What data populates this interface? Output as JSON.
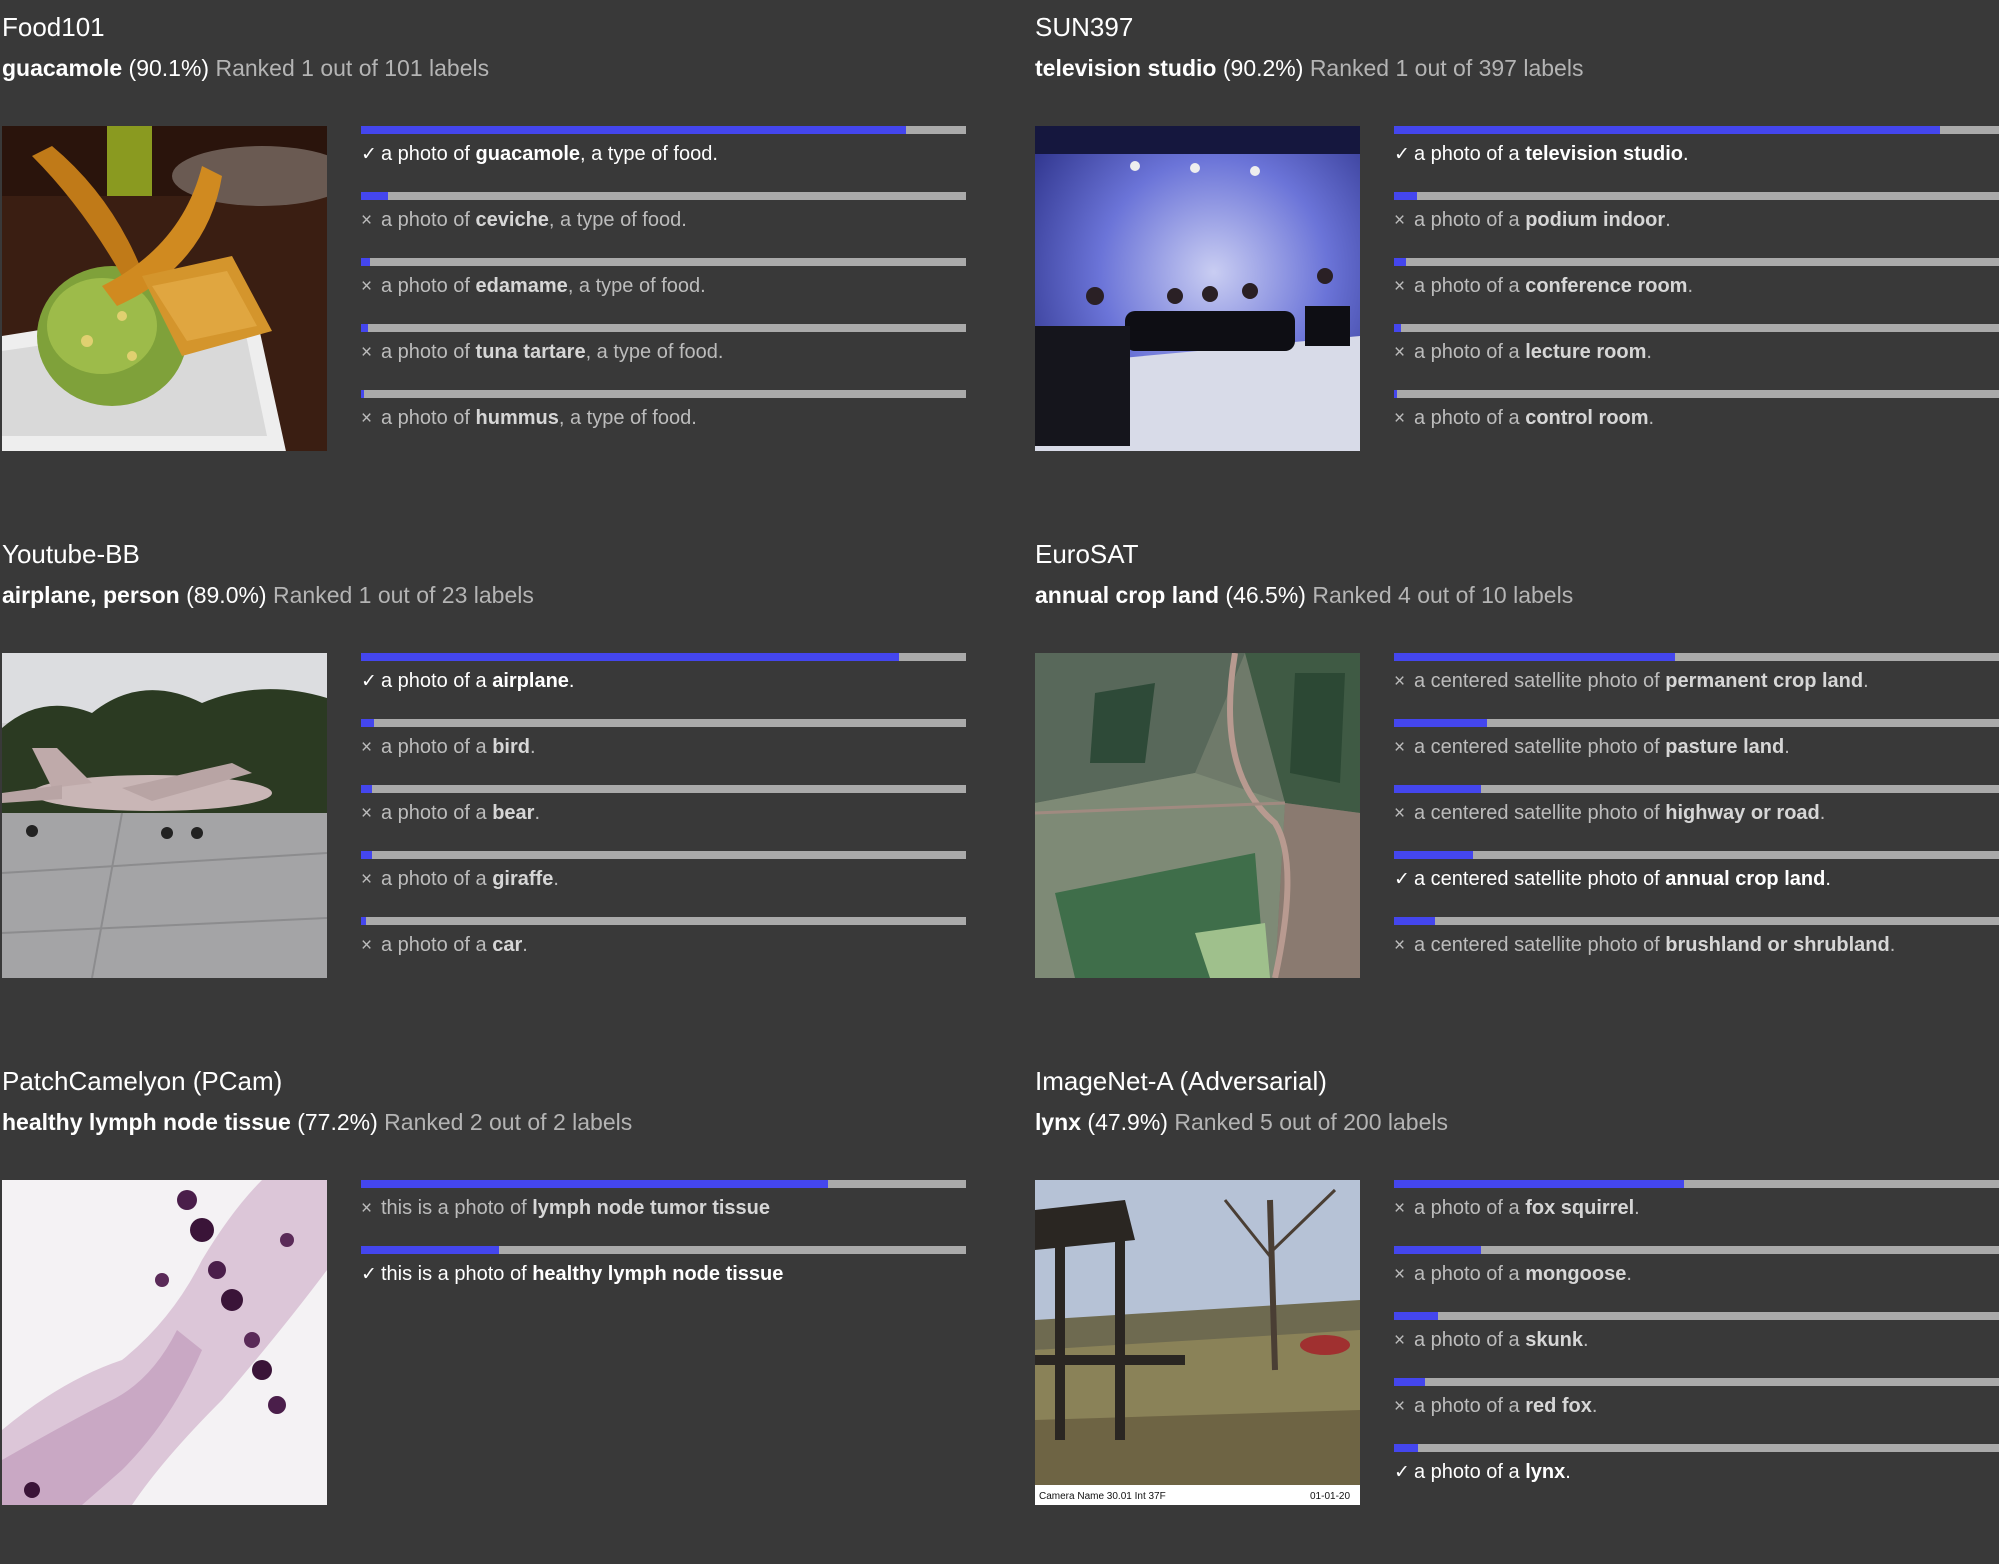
{
  "panels": [
    {
      "dataset": "Food101",
      "label": "guacamole",
      "score": "(90.1%)",
      "rank_text": "Ranked 1 out of 101 labels",
      "image_icon": "guacamole-photo",
      "options": [
        {
          "mark": "✓",
          "correct": true,
          "prefix": "a photo of ",
          "cls": "guacamole",
          "suffix": ", a type of food.",
          "prob": 0.901
        },
        {
          "mark": "×",
          "correct": false,
          "prefix": "a photo of ",
          "cls": "ceviche",
          "suffix": ", a type of food.",
          "prob": 0.045
        },
        {
          "mark": "×",
          "correct": false,
          "prefix": "a photo of ",
          "cls": "edamame",
          "suffix": ", a type of food.",
          "prob": 0.015
        },
        {
          "mark": "×",
          "correct": false,
          "prefix": "a photo of ",
          "cls": "tuna tartare",
          "suffix": ", a type of food.",
          "prob": 0.012
        },
        {
          "mark": "×",
          "correct": false,
          "prefix": "a photo of ",
          "cls": "hummus",
          "suffix": ", a type of food.",
          "prob": 0.005
        }
      ]
    },
    {
      "dataset": "SUN397",
      "label": "television studio",
      "score": "(90.2%)",
      "rank_text": "Ranked 1 out of 397 labels",
      "image_icon": "television-studio-photo",
      "options": [
        {
          "mark": "✓",
          "correct": true,
          "prefix": "a photo of a ",
          "cls": "television studio",
          "suffix": ".",
          "prob": 0.902
        },
        {
          "mark": "×",
          "correct": false,
          "prefix": "a photo of a ",
          "cls": "podium indoor",
          "suffix": ".",
          "prob": 0.038
        },
        {
          "mark": "×",
          "correct": false,
          "prefix": "a photo of a ",
          "cls": "conference room",
          "suffix": ".",
          "prob": 0.02
        },
        {
          "mark": "×",
          "correct": false,
          "prefix": "a photo of a ",
          "cls": "lecture room",
          "suffix": ".",
          "prob": 0.012
        },
        {
          "mark": "×",
          "correct": false,
          "prefix": "a photo of a ",
          "cls": "control room",
          "suffix": ".",
          "prob": 0.005
        }
      ]
    },
    {
      "dataset": "Youtube-BB",
      "label": "airplane, person",
      "score": "(89.0%)",
      "rank_text": "Ranked 1 out of 23 labels",
      "image_icon": "airplane-photo",
      "options": [
        {
          "mark": "✓",
          "correct": true,
          "prefix": "a photo of a ",
          "cls": "airplane",
          "suffix": ".",
          "prob": 0.89
        },
        {
          "mark": "×",
          "correct": false,
          "prefix": "a photo of a ",
          "cls": "bird",
          "suffix": ".",
          "prob": 0.022
        },
        {
          "mark": "×",
          "correct": false,
          "prefix": "a photo of a ",
          "cls": "bear",
          "suffix": ".",
          "prob": 0.018
        },
        {
          "mark": "×",
          "correct": false,
          "prefix": "a photo of a ",
          "cls": "giraffe",
          "suffix": ".",
          "prob": 0.018
        },
        {
          "mark": "×",
          "correct": false,
          "prefix": "a photo of a ",
          "cls": "car",
          "suffix": ".",
          "prob": 0.008
        }
      ]
    },
    {
      "dataset": "EuroSAT",
      "label": "annual crop land",
      "score": "(46.5%)",
      "rank_text": "Ranked 4 out of 10 labels",
      "image_icon": "satellite-photo",
      "options": [
        {
          "mark": "×",
          "correct": false,
          "prefix": "a centered satellite photo of ",
          "cls": "permanent crop land",
          "suffix": ".",
          "prob": 0.465
        },
        {
          "mark": "×",
          "correct": false,
          "prefix": "a centered satellite photo of ",
          "cls": "pasture land",
          "suffix": ".",
          "prob": 0.153
        },
        {
          "mark": "×",
          "correct": false,
          "prefix": "a centered satellite photo of ",
          "cls": "highway or road",
          "suffix": ".",
          "prob": 0.144
        },
        {
          "mark": "✓",
          "correct": true,
          "prefix": "a centered satellite photo of ",
          "cls": "annual crop land",
          "suffix": ".",
          "prob": 0.13
        },
        {
          "mark": "×",
          "correct": false,
          "prefix": "a centered satellite photo of ",
          "cls": "brushland or shrubland",
          "suffix": ".",
          "prob": 0.068
        }
      ]
    },
    {
      "dataset": "PatchCamelyon (PCam)",
      "label": "healthy lymph node tissue",
      "score": "(77.2%)",
      "rank_text": "Ranked 2 out of 2 labels",
      "image_icon": "tissue-photo",
      "options": [
        {
          "mark": "×",
          "correct": false,
          "prefix": "this is a photo of ",
          "cls": "lymph node tumor tissue",
          "suffix": "",
          "prob": 0.772
        },
        {
          "mark": "✓",
          "correct": true,
          "prefix": "this is a photo of ",
          "cls": "healthy lymph node tissue",
          "suffix": "",
          "prob": 0.228
        }
      ]
    },
    {
      "dataset": "ImageNet-A (Adversarial)",
      "label": "lynx",
      "score": "(47.9%)",
      "rank_text": "Ranked 5 out of 200 labels",
      "image_icon": "park-photo",
      "options": [
        {
          "mark": "×",
          "correct": false,
          "prefix": "a photo of a ",
          "cls": "fox squirrel",
          "suffix": ".",
          "prob": 0.479
        },
        {
          "mark": "×",
          "correct": false,
          "prefix": "a photo of a ",
          "cls": "mongoose",
          "suffix": ".",
          "prob": 0.144
        },
        {
          "mark": "×",
          "correct": false,
          "prefix": "a photo of a ",
          "cls": "skunk",
          "suffix": ".",
          "prob": 0.072
        },
        {
          "mark": "×",
          "correct": false,
          "prefix": "a photo of a ",
          "cls": "red fox",
          "suffix": ".",
          "prob": 0.052
        },
        {
          "mark": "✓",
          "correct": true,
          "prefix": "a photo of a ",
          "cls": "lynx",
          "suffix": ".",
          "prob": 0.04
        }
      ]
    }
  ],
  "image_text": {
    "park_caption_left": "Camera Name 30.01 Int 37F",
    "park_caption_right": "01-01-20"
  },
  "colors": {
    "background": "#393939",
    "bar_fill": "#4446ee",
    "bar_track": "#aaaaaa"
  }
}
